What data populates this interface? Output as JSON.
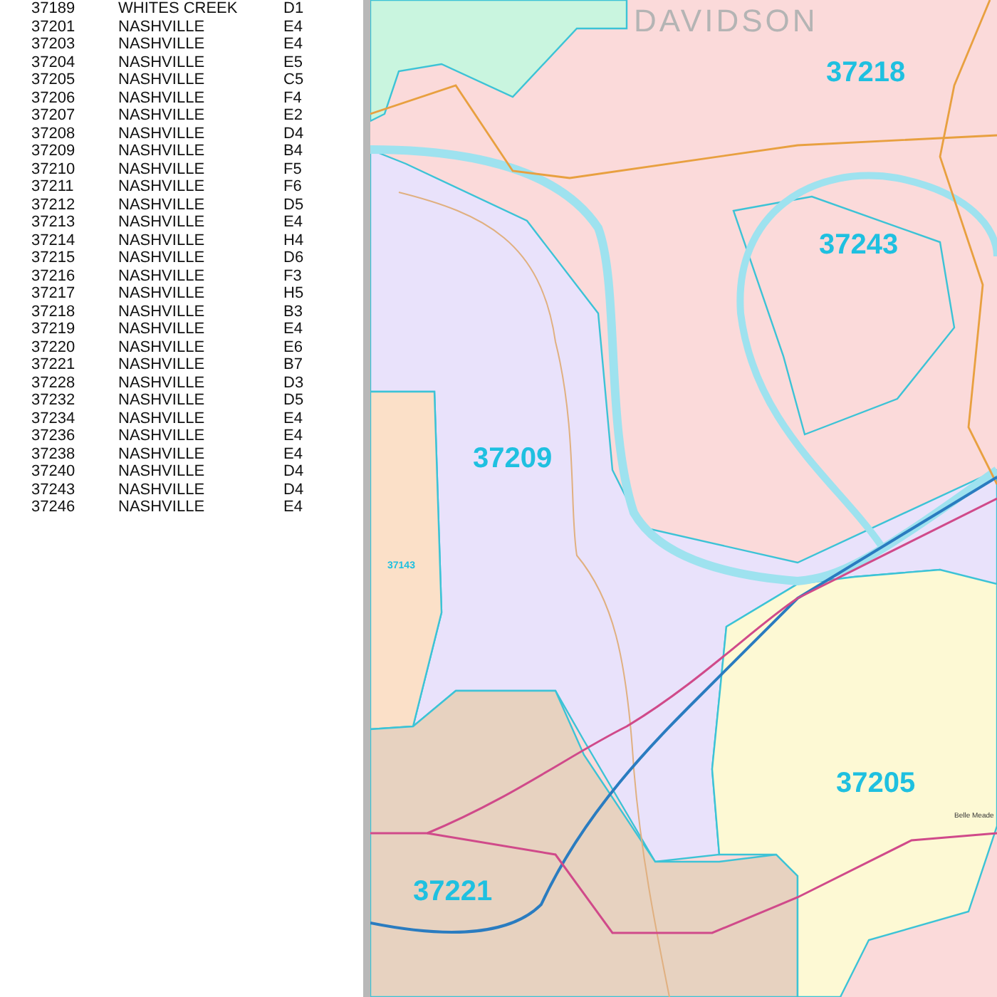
{
  "index_rows": [
    {
      "zip": "37189",
      "city": "WHITES CREEK",
      "grid": "D1"
    },
    {
      "zip": "37201",
      "city": "NASHVILLE",
      "grid": "E4"
    },
    {
      "zip": "37203",
      "city": "NASHVILLE",
      "grid": "E4"
    },
    {
      "zip": "37204",
      "city": "NASHVILLE",
      "grid": "E5"
    },
    {
      "zip": "37205",
      "city": "NASHVILLE",
      "grid": "C5"
    },
    {
      "zip": "37206",
      "city": "NASHVILLE",
      "grid": "F4"
    },
    {
      "zip": "37207",
      "city": "NASHVILLE",
      "grid": "E2"
    },
    {
      "zip": "37208",
      "city": "NASHVILLE",
      "grid": "D4"
    },
    {
      "zip": "37209",
      "city": "NASHVILLE",
      "grid": "B4"
    },
    {
      "zip": "37210",
      "city": "NASHVILLE",
      "grid": "F5"
    },
    {
      "zip": "37211",
      "city": "NASHVILLE",
      "grid": "F6"
    },
    {
      "zip": "37212",
      "city": "NASHVILLE",
      "grid": "D5"
    },
    {
      "zip": "37213",
      "city": "NASHVILLE",
      "grid": "E4"
    },
    {
      "zip": "37214",
      "city": "NASHVILLE",
      "grid": "H4"
    },
    {
      "zip": "37215",
      "city": "NASHVILLE",
      "grid": "D6"
    },
    {
      "zip": "37216",
      "city": "NASHVILLE",
      "grid": "F3"
    },
    {
      "zip": "37217",
      "city": "NASHVILLE",
      "grid": "H5"
    },
    {
      "zip": "37218",
      "city": "NASHVILLE",
      "grid": "B3"
    },
    {
      "zip": "37219",
      "city": "NASHVILLE",
      "grid": "E4"
    },
    {
      "zip": "37220",
      "city": "NASHVILLE",
      "grid": "E6"
    },
    {
      "zip": "37221",
      "city": "NASHVILLE",
      "grid": "B7"
    },
    {
      "zip": "37228",
      "city": "NASHVILLE",
      "grid": "D3"
    },
    {
      "zip": "37232",
      "city": "NASHVILLE",
      "grid": "D5"
    },
    {
      "zip": "37234",
      "city": "NASHVILLE",
      "grid": "E4"
    },
    {
      "zip": "37236",
      "city": "NASHVILLE",
      "grid": "E4"
    },
    {
      "zip": "37238",
      "city": "NASHVILLE",
      "grid": "E4"
    },
    {
      "zip": "37240",
      "city": "NASHVILLE",
      "grid": "D4"
    },
    {
      "zip": "37243",
      "city": "NASHVILLE",
      "grid": "D4"
    },
    {
      "zip": "37246",
      "city": "NASHVILLE",
      "grid": "E4"
    }
  ],
  "map": {
    "county_label": "DAVIDSON",
    "zip_labels": [
      {
        "text": "37218",
        "kind": "major"
      },
      {
        "text": "37243",
        "kind": "major"
      },
      {
        "text": "37209",
        "kind": "major"
      },
      {
        "text": "37143",
        "kind": "minor"
      },
      {
        "text": "37205",
        "kind": "major"
      },
      {
        "text": "37221",
        "kind": "major"
      }
    ],
    "place_labels": [
      "Belle Meade"
    ]
  }
}
